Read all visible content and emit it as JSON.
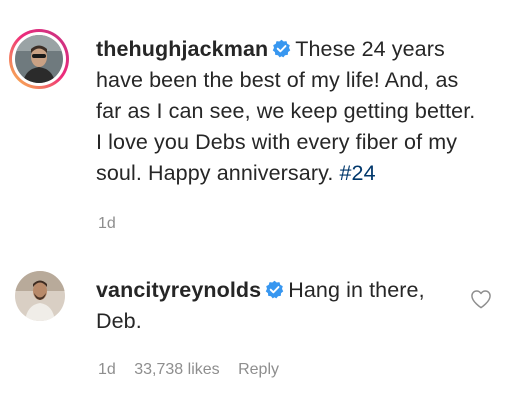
{
  "comments": [
    {
      "username": "thehughjackman",
      "verified": true,
      "text_lines": [
        "These 24 years",
        "have been the best of my life! And, as",
        "far as I can see, we keep getting better.",
        "I love you Debs with every fiber of my",
        "soul. Happy anniversary."
      ],
      "hashtag": "#24",
      "time": "1d",
      "has_story_ring": true
    },
    {
      "username": "vancityreynolds",
      "verified": true,
      "text_lines": [
        "Hang in there,",
        "Deb."
      ],
      "time": "1d",
      "likes": "33,738 likes",
      "reply_label": "Reply",
      "has_story_ring": false
    }
  ],
  "colors": {
    "verified_blue": "#3897f0",
    "hashtag": "#00376b",
    "meta_gray": "#8e8e8e"
  },
  "icons": [
    "verified-badge-icon",
    "heart-icon"
  ]
}
